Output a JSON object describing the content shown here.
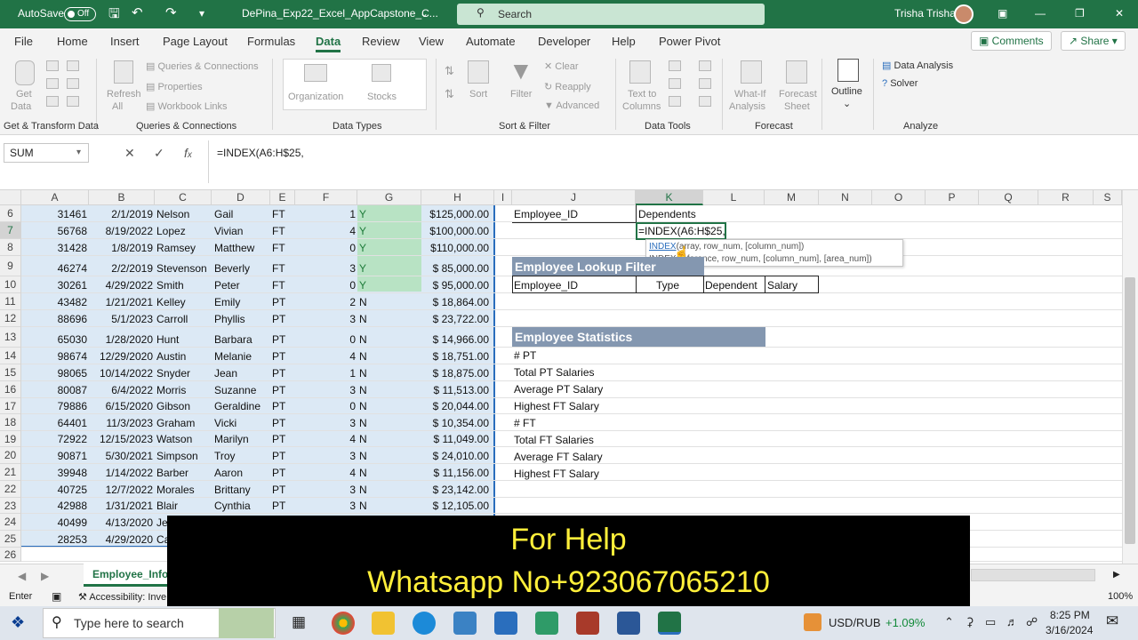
{
  "titlebar": {
    "autosave": "AutoSave",
    "autosave_state": "Off",
    "filename": "DePina_Exp22_Excel_AppCapstone_C...",
    "search_placeholder": "Search",
    "user": "Trisha Trisha"
  },
  "menu": {
    "tabs": [
      "File",
      "Home",
      "Insert",
      "Page Layout",
      "Formulas",
      "Data",
      "Review",
      "View",
      "Automate",
      "Developer",
      "Help",
      "Power Pivot"
    ],
    "active": "Data",
    "comments": "Comments",
    "share": "Share"
  },
  "ribbon": {
    "get_data": "Get",
    "get_data2": "Data",
    "refresh": "Refresh",
    "refresh2": "All",
    "queries": "Queries & Connections",
    "properties": "Properties",
    "workbook_links": "Workbook Links",
    "organization": "Organization",
    "stocks": "Stocks",
    "sort": "Sort",
    "filter": "Filter",
    "clear": "Clear",
    "reapply": "Reapply",
    "advanced": "Advanced",
    "text_to_columns": "Text to",
    "text_to_columns2": "Columns",
    "what_if": "What-If",
    "what_if2": "Analysis",
    "forecast_sheet": "Forecast",
    "forecast_sheet2": "Sheet",
    "outline": "Outline",
    "data_analysis": "Data Analysis",
    "solver": "Solver",
    "groups": [
      "Get & Transform Data",
      "Queries & Connections",
      "Data Types",
      "Sort & Filter",
      "Data Tools",
      "Forecast",
      "Analyze"
    ]
  },
  "formula_bar": {
    "name_box": "SUM",
    "formula": "=INDEX(A6:H$25,"
  },
  "columns": [
    "A",
    "B",
    "C",
    "D",
    "E",
    "F",
    "G",
    "H",
    "I",
    "J",
    "K",
    "L",
    "M",
    "N",
    "O",
    "P",
    "Q",
    "R",
    "S"
  ],
  "rows": [
    {
      "r": "6",
      "a": "31461",
      "b": "2/1/2019",
      "c": "Nelson",
      "d": "Gail",
      "e": "FT",
      "f": "1",
      "g": "Y",
      "h": "$125,000.00"
    },
    {
      "r": "7",
      "a": "56768",
      "b": "8/19/2022",
      "c": "Lopez",
      "d": "Vivian",
      "e": "FT",
      "f": "4",
      "g": "Y",
      "h": "$100,000.00"
    },
    {
      "r": "8",
      "a": "31428",
      "b": "1/8/2019",
      "c": "Ramsey",
      "d": "Matthew",
      "e": "FT",
      "f": "0",
      "g": "Y",
      "h": "$110,000.00"
    },
    {
      "r": "9",
      "a": "46274",
      "b": "2/2/2019",
      "c": "Stevenson",
      "d": "Beverly",
      "e": "FT",
      "f": "3",
      "g": "Y",
      "h": "$  85,000.00"
    },
    {
      "r": "10",
      "a": "30261",
      "b": "4/29/2022",
      "c": "Smith",
      "d": "Peter",
      "e": "FT",
      "f": "0",
      "g": "Y",
      "h": "$  95,000.00"
    },
    {
      "r": "11",
      "a": "43482",
      "b": "1/21/2021",
      "c": "Kelley",
      "d": "Emily",
      "e": "PT",
      "f": "2",
      "g": "N",
      "h": "$  18,864.00"
    },
    {
      "r": "12",
      "a": "88696",
      "b": "5/1/2023",
      "c": "Carroll",
      "d": "Phyllis",
      "e": "PT",
      "f": "3",
      "g": "N",
      "h": "$  23,722.00"
    },
    {
      "r": "13",
      "a": "65030",
      "b": "1/28/2020",
      "c": "Hunt",
      "d": "Barbara",
      "e": "PT",
      "f": "0",
      "g": "N",
      "h": "$  14,966.00"
    },
    {
      "r": "14",
      "a": "98674",
      "b": "12/29/2020",
      "c": "Austin",
      "d": "Melanie",
      "e": "PT",
      "f": "4",
      "g": "N",
      "h": "$  18,751.00"
    },
    {
      "r": "15",
      "a": "98065",
      "b": "10/14/2022",
      "c": "Snyder",
      "d": "Jean",
      "e": "PT",
      "f": "1",
      "g": "N",
      "h": "$  18,875.00"
    },
    {
      "r": "16",
      "a": "80087",
      "b": "6/4/2022",
      "c": "Morris",
      "d": "Suzanne",
      "e": "PT",
      "f": "3",
      "g": "N",
      "h": "$  11,513.00"
    },
    {
      "r": "17",
      "a": "79886",
      "b": "6/15/2020",
      "c": "Gibson",
      "d": "Geraldine",
      "e": "PT",
      "f": "0",
      "g": "N",
      "h": "$  20,044.00"
    },
    {
      "r": "18",
      "a": "64401",
      "b": "11/3/2023",
      "c": "Graham",
      "d": "Vicki",
      "e": "PT",
      "f": "3",
      "g": "N",
      "h": "$  10,354.00"
    },
    {
      "r": "19",
      "a": "72922",
      "b": "12/15/2023",
      "c": "Watson",
      "d": "Marilyn",
      "e": "PT",
      "f": "4",
      "g": "N",
      "h": "$  11,049.00"
    },
    {
      "r": "20",
      "a": "90871",
      "b": "5/30/2021",
      "c": "Simpson",
      "d": "Troy",
      "e": "PT",
      "f": "3",
      "g": "N",
      "h": "$  24,010.00"
    },
    {
      "r": "21",
      "a": "39948",
      "b": "1/14/2022",
      "c": "Barber",
      "d": "Aaron",
      "e": "PT",
      "f": "4",
      "g": "N",
      "h": "$  11,156.00"
    },
    {
      "r": "22",
      "a": "40725",
      "b": "12/7/2022",
      "c": "Morales",
      "d": "Brittany",
      "e": "PT",
      "f": "3",
      "g": "N",
      "h": "$  23,142.00"
    },
    {
      "r": "23",
      "a": "42988",
      "b": "1/31/2021",
      "c": "Blair",
      "d": "Cynthia",
      "e": "PT",
      "f": "3",
      "g": "N",
      "h": "$  12,105.00"
    },
    {
      "r": "24",
      "a": "40499",
      "b": "4/13/2020",
      "c": "Je",
      "d": "",
      "e": "",
      "f": "",
      "g": "",
      "h": ""
    },
    {
      "r": "25",
      "a": "28253",
      "b": "4/29/2020",
      "c": "Ca",
      "d": "",
      "e": "",
      "f": "",
      "g": "",
      "h": ""
    },
    {
      "r": "26",
      "a": "",
      "b": "",
      "c": "",
      "d": "",
      "e": "",
      "f": "",
      "g": "",
      "h": ""
    }
  ],
  "right_area": {
    "j6": "Employee_ID",
    "k6": "Dependents",
    "k7": "=INDEX(A6:H$25,",
    "tip1_fn": "INDEX",
    "tip1_args": "(array, row_num, [column_num])",
    "tip2_fn": "INDEX",
    "tip2_args": "(reference, row_num, [column_num], [area_num])",
    "lookup_title": "Employee Lookup Filter",
    "lookup_cols": [
      "Employee_ID",
      "Type",
      "Dependent",
      "Salary"
    ],
    "stats_title": "Employee Statistics",
    "stats": [
      "# PT",
      "Total PT Salaries",
      "Average PT Salary",
      "Highest FT Salary",
      "# FT",
      "Total FT Salaries",
      "Average FT Salary",
      "Highest FT Salary"
    ]
  },
  "sheet_tab": "Employee_Info",
  "status": {
    "mode": "Enter",
    "accessibility": "Accessibility: Inve",
    "zoom": "100%"
  },
  "overlay": {
    "line1": "For Help",
    "line2": "Whatsapp No+923067065210"
  },
  "taskbar": {
    "search_placeholder": "Type here to search",
    "ticker": "USD/RUB",
    "ticker_change": "+1.09%",
    "time": "8:25 PM",
    "date": "3/16/2024"
  }
}
